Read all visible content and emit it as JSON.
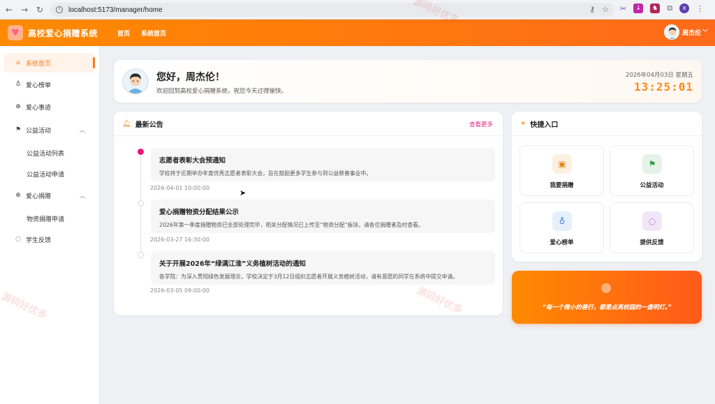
{
  "browser": {
    "url": "localhost:5173/manager/home"
  },
  "header": {
    "app_title": "高校爱心捐赠系统",
    "nav": [
      "首页",
      "系统首页"
    ],
    "user_name": "周杰伦"
  },
  "sidebar": {
    "items": [
      {
        "label": "系统首页",
        "icon": "home-icon",
        "active": true
      },
      {
        "label": "爱心榜单",
        "icon": "medal-icon"
      },
      {
        "label": "爱心事迹",
        "icon": "medkit-icon"
      },
      {
        "label": "公益活动",
        "icon": "flag-icon",
        "expanded": true
      },
      {
        "label": "公益活动列表",
        "sub": true
      },
      {
        "label": "公益活动申请",
        "sub": true
      },
      {
        "label": "爱心捐赠",
        "icon": "medkit-icon",
        "expanded": true
      },
      {
        "label": "物资捐赠申请",
        "sub": true
      },
      {
        "label": "学生反馈",
        "icon": "chat-icon"
      }
    ]
  },
  "welcome": {
    "greeting": "您好，周杰伦！",
    "subtitle": "欢迎回到高校爱心捐赠系统，祝您今天过得愉快。",
    "date": "2026年04月03日 星期五",
    "time": "13:25:01"
  },
  "announcements": {
    "title": "最新公告",
    "more": "查看更多",
    "items": [
      {
        "title": "志愿者表彰大会预通知",
        "body": "学校将于近期举办年度优秀志愿者表彰大会，旨在鼓励更多学生参与到公益慈善事业中。",
        "time": "2026-04-01 10:00:00"
      },
      {
        "title": "爱心捐赠物资分配结果公示",
        "body": "2026年第一季度捐赠物资已全部处理完毕，相关分配情况已上传至“物资分配”板块，请各位捐赠者及时查看。",
        "time": "2026-03-27 16:30:00"
      },
      {
        "title": "关于开展2026年“绿满江淮”义务植树活动的通知",
        "body": "各学院：为深入贯彻绿色发展理念，学校决定于3月12日组织志愿者开展义务植树活动，请有意愿的同学在系统中提交申请。",
        "time": "2026-03-05 09:00:00"
      }
    ]
  },
  "quick": {
    "title": "快捷入口",
    "tiles": [
      {
        "label": "我要捐赠",
        "icon": "gift-icon",
        "bg": "#fdf0e0",
        "fg": "#e08a1a"
      },
      {
        "label": "公益活动",
        "icon": "flag-icon",
        "bg": "#e6f3e8",
        "fg": "#2e9c48"
      },
      {
        "label": "爱心榜单",
        "icon": "medal-icon",
        "bg": "#e6f0fb",
        "fg": "#3a7bd5"
      },
      {
        "label": "提供反馈",
        "icon": "chat-icon",
        "bg": "#f1e6f7",
        "fg": "#9b3ab5"
      }
    ]
  },
  "motto": {
    "text": "“每一个微小的善行，都是点亮校园的一盏明灯。”"
  },
  "watermark": "源码好优多",
  "colors": {
    "accent": "#ff7a14",
    "pink": "#e0297f"
  }
}
